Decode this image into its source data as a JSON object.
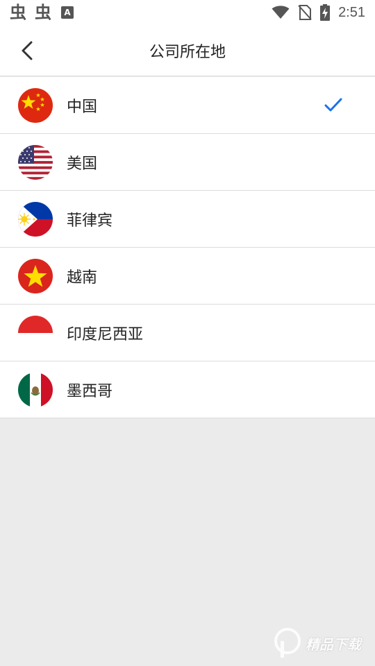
{
  "status_bar": {
    "app_icon_1": "虫",
    "app_icon_2": "虫",
    "notification_icon": "A",
    "time": "2:51"
  },
  "header": {
    "title": "公司所在地"
  },
  "countries": [
    {
      "name": "中国",
      "flag": "china-flag-icon",
      "selected": true
    },
    {
      "name": "美国",
      "flag": "usa-flag-icon",
      "selected": false
    },
    {
      "name": "菲律宾",
      "flag": "philippines-flag-icon",
      "selected": false
    },
    {
      "name": "越南",
      "flag": "vietnam-flag-icon",
      "selected": false
    },
    {
      "name": "印度尼西亚",
      "flag": "indonesia-flag-icon",
      "selected": false
    },
    {
      "name": "墨西哥",
      "flag": "mexico-flag-icon",
      "selected": false
    }
  ],
  "colors": {
    "accent": "#1a73e8",
    "divider": "#dcdcdc",
    "page_background": "#ebebeb"
  },
  "watermark": {
    "text": "精品下载"
  }
}
